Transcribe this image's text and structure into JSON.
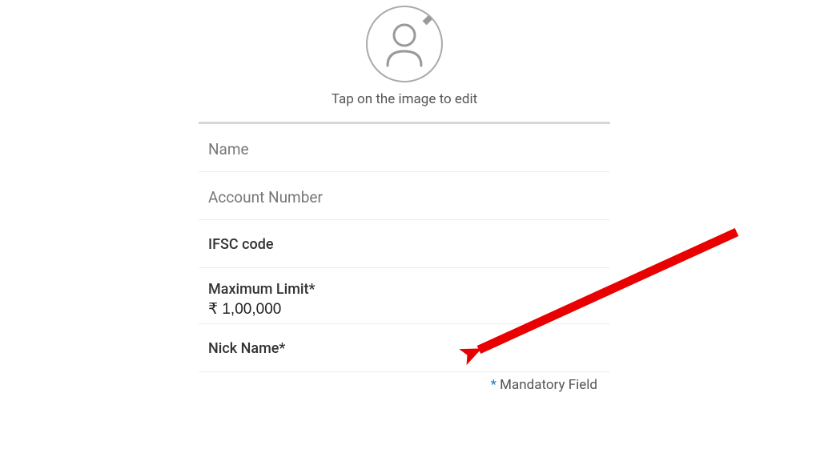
{
  "avatar": {
    "caption": "Tap on the image to edit"
  },
  "fields": {
    "name_label": "Name",
    "account_label": "Account Number",
    "ifsc_label": "IFSC code",
    "maxlimit_label": "Maximum Limit*",
    "maxlimit_value": "₹ 1,00,000",
    "nick_label": "Nick Name*"
  },
  "footer": {
    "asterisk": "*",
    "mandatory_text": " Mandatory Field"
  }
}
